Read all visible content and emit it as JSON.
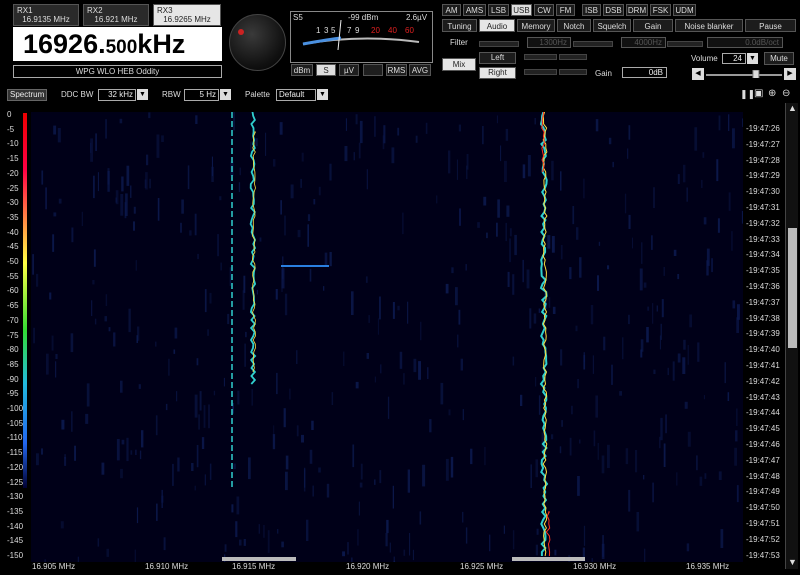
{
  "receivers": [
    {
      "label": "RX1",
      "freq": "16.9135 MHz",
      "active": false
    },
    {
      "label": "RX2",
      "freq": "16.921 MHz",
      "active": false
    },
    {
      "label": "RX3",
      "freq": "16.9265 MHz",
      "active": true
    }
  ],
  "frequency": {
    "main": "16926.",
    "small": "500",
    "unit": "kHz"
  },
  "station": "WPG WLO HEB Oddity",
  "meter": {
    "s_label": "S5",
    "dbm": "-99 dBm",
    "uv": "2.6µV",
    "scale": [
      "1",
      "3",
      "5",
      "7",
      "9",
      "20",
      "40",
      "60"
    ],
    "buttons": [
      "dBm",
      "S",
      "µV",
      "",
      "RMS",
      "AVG"
    ],
    "selected": "S"
  },
  "modes": [
    "AM",
    "AMS",
    "LSB",
    "USB",
    "CW",
    "FM",
    "ISB",
    "DSB",
    "DRM",
    "FSK",
    "UDM"
  ],
  "mode_selected": "USB",
  "tabs": [
    "Tuning",
    "Audio",
    "Memory",
    "Notch",
    "Squelch",
    "Gain",
    "Noise blanker",
    "Pause"
  ],
  "tab_selected": "Audio",
  "audio": {
    "filter_label": "Filter",
    "filter_low": "1300Hz",
    "filter_high": "4000Hz",
    "slope": "0.0dB/oct",
    "mix": "Mix",
    "left": "Left",
    "right": "Right",
    "gain_label": "Gain",
    "gain_value": "0dB",
    "volume_label": "Volume",
    "volume_value": "24",
    "mute": "Mute",
    "volume_level": 0.67
  },
  "toolbar": {
    "spectrum": "Spectrum",
    "ddc_bw_label": "DDC BW",
    "ddc_bw": "32 kHz",
    "rbw_label": "RBW",
    "rbw": "5 Hz",
    "palette_label": "Palette",
    "palette": "Default"
  },
  "y_axis": [
    "0",
    "-5",
    "-10",
    "-15",
    "-20",
    "-25",
    "-30",
    "-35",
    "-40",
    "-45",
    "-50",
    "-55",
    "-60",
    "-65",
    "-70",
    "-75",
    "-80",
    "-85",
    "-90",
    "-95",
    "-100",
    "-105",
    "-110",
    "-115",
    "-120",
    "-125",
    "-130",
    "-135",
    "-140",
    "-145",
    "-150"
  ],
  "times": [
    "19:47:26",
    "19:47:27",
    "19:47:28",
    "19:47:29",
    "19:47:30",
    "19:47:31",
    "19:47:32",
    "19:47:33",
    "19:47:34",
    "19:47:35",
    "19:47:36",
    "19:47:37",
    "19:47:38",
    "19:47:39",
    "19:47:40",
    "19:47:41",
    "19:47:42",
    "19:47:43",
    "19:47:44",
    "19:47:45",
    "19:47:46",
    "19:47:47",
    "19:47:48",
    "19:47:49",
    "19:47:50",
    "19:47:51",
    "19:47:52",
    "19:47:53"
  ],
  "x_axis": [
    "16.905 MHz",
    "16.910 MHz",
    "16.915 MHz",
    "16.920 MHz",
    "16.925 MHz",
    "16.930 MHz",
    "16.935 MHz"
  ],
  "colors": {
    "accent": "#e6e6e6",
    "signal_hot": "#ff3020",
    "signal_warm": "#ffe040",
    "signal_cool": "#30d0d0",
    "waterfall_bg": "#000018"
  }
}
